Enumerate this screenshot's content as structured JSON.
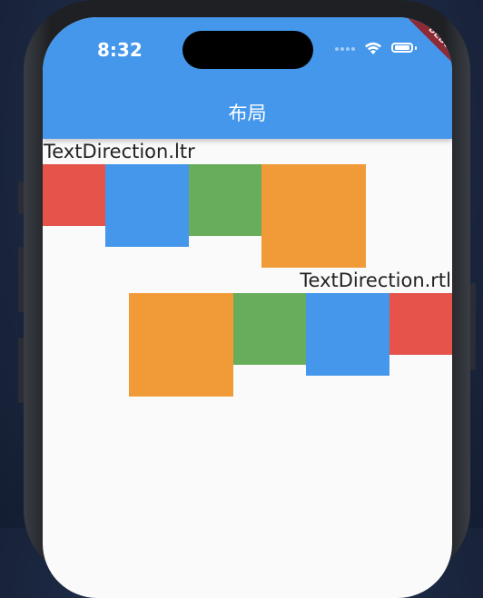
{
  "status_bar": {
    "time": "8:32"
  },
  "app_bar": {
    "title": "布局"
  },
  "debug_banner": {
    "text": "DEBUG"
  },
  "sections": [
    {
      "label": "TextDirection.ltr",
      "boxes": [
        "red",
        "blue",
        "green",
        "orange"
      ]
    },
    {
      "label": "TextDirection.rtl",
      "boxes": [
        "orange",
        "green",
        "blue",
        "red"
      ]
    }
  ],
  "colors": {
    "app_bar": "#4497ea",
    "red": "#e5534b",
    "blue": "#4497ea",
    "green": "#67ad5b",
    "orange": "#f19b38",
    "background": "#fafafa"
  }
}
